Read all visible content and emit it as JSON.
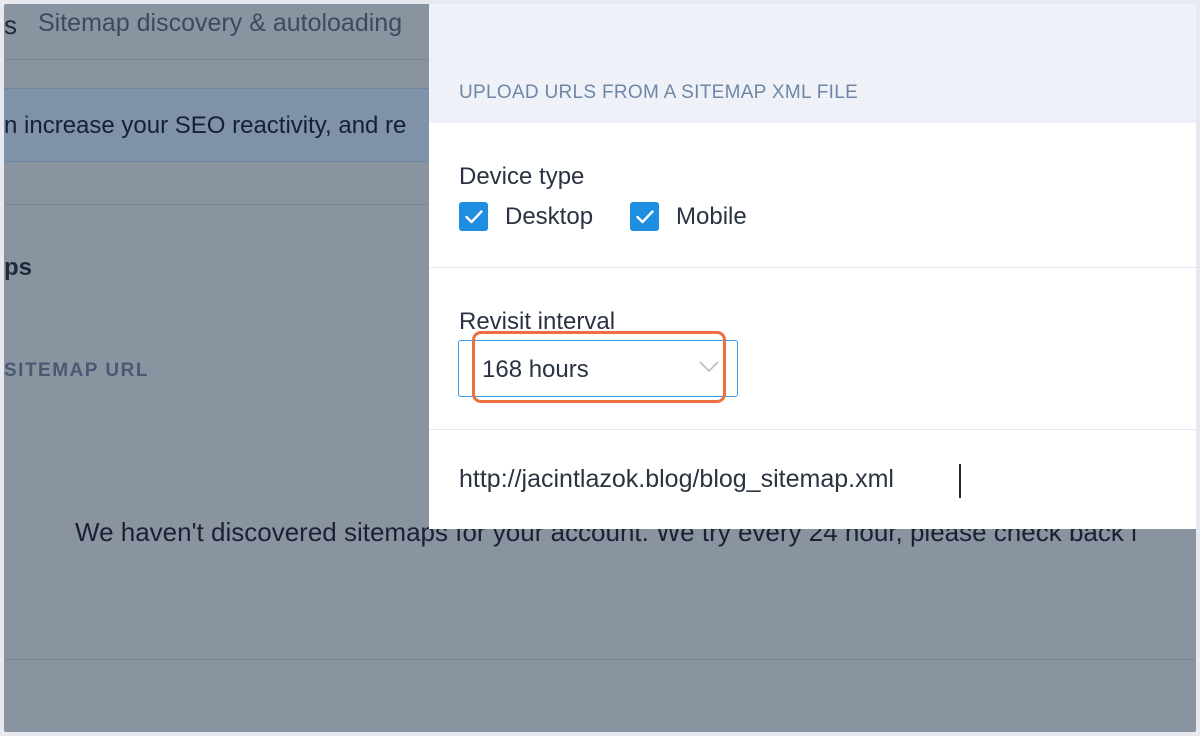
{
  "background": {
    "title_fragment": "s",
    "subtitle": "Sitemap discovery & autoloading",
    "info_text": "n increase your SEO reactivity, and re",
    "section_title_fragment": "ps",
    "column_header": "SITEMAP URL",
    "empty_message": "We haven't discovered sitemaps for your account. We try every 24 hour, please check back l"
  },
  "modal": {
    "header_title": "UPLOAD URLS FROM A SITEMAP XML FILE",
    "device_type": {
      "label": "Device type",
      "options": [
        {
          "label": "Desktop",
          "checked": true
        },
        {
          "label": "Mobile",
          "checked": true
        }
      ]
    },
    "revisit_interval": {
      "label": "Revisit interval",
      "selected": "168 hours"
    },
    "sitemap_url": "http://jacintlazok.blog/blog_sitemap.xml"
  },
  "colors": {
    "accent": "#1d8ee0",
    "highlight": "#ee6e3f",
    "overlay": "#8a94a1"
  }
}
